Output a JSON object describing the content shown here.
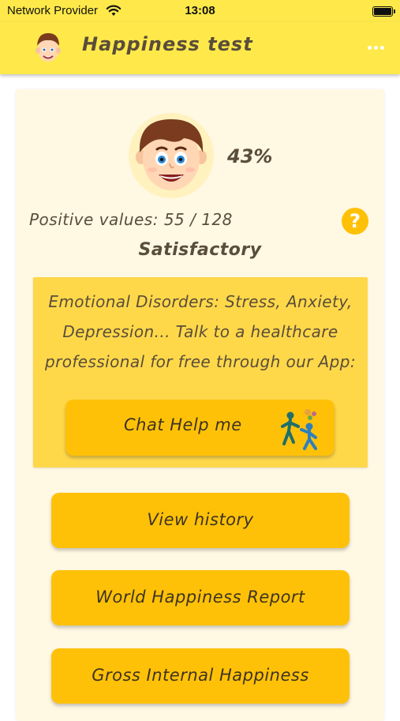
{
  "status_bar": {
    "carrier": "Network Provider",
    "time": "13:08"
  },
  "app_bar": {
    "title": "Happiness test",
    "icons": [
      "avatar-face-icon",
      "more-options-icon"
    ]
  },
  "result": {
    "percent": "43%",
    "positive_values": "Positive values: 55 / 128",
    "level": "Satisfactory"
  },
  "info": {
    "text": "Emotional Disorders: Stress, Anxiety, Depression... Talk to a healthcare professional for free through our App:",
    "chat_button": "Chat Help me"
  },
  "menu": {
    "items": [
      {
        "label": "View history"
      },
      {
        "label": "World Happiness Report"
      },
      {
        "label": "Gross Internal Happiness"
      }
    ]
  },
  "colors": {
    "app_bar": "#ffe94a",
    "card": "#fff8e3",
    "info_box": "#ffd84a",
    "button": "#ffc107",
    "text": "#5a4d3a"
  }
}
